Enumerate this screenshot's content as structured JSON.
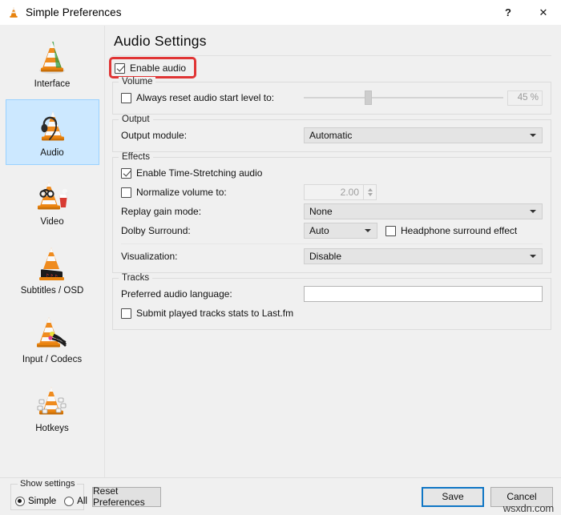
{
  "window": {
    "title": "Simple Preferences",
    "icon": "vlc-cone-icon",
    "help_label": "?",
    "close_label": "✕"
  },
  "sidebar": {
    "items": [
      {
        "label": "Interface",
        "icon": "vlc-cone-icon",
        "selected": false
      },
      {
        "label": "Audio",
        "icon": "vlc-cone-headphones-icon",
        "selected": true
      },
      {
        "label": "Video",
        "icon": "vlc-cone-popcorn-icon",
        "selected": false
      },
      {
        "label": "Subtitles / OSD",
        "icon": "vlc-cone-subtitles-icon",
        "selected": false
      },
      {
        "label": "Input / Codecs",
        "icon": "vlc-cone-cables-icon",
        "selected": false
      },
      {
        "label": "Hotkeys",
        "icon": "vlc-cone-keyboard-icon",
        "selected": false
      }
    ]
  },
  "content": {
    "page_title": "Audio Settings",
    "enable_audio": {
      "label": "Enable audio",
      "checked": true,
      "highlight_color": "#e03434"
    },
    "volume": {
      "group_label": "Volume",
      "reset_label": "Always reset audio start level to:",
      "reset_checked": false,
      "slider_value": "45 %",
      "slider_percent": 32
    },
    "output": {
      "group_label": "Output",
      "module_label": "Output module:",
      "module_value": "Automatic"
    },
    "effects": {
      "group_label": "Effects",
      "time_stretch_label": "Enable Time-Stretching audio",
      "time_stretch_checked": true,
      "normalize_label": "Normalize volume to:",
      "normalize_checked": false,
      "normalize_value": "2.00",
      "replay_gain_label": "Replay gain mode:",
      "replay_gain_value": "None",
      "dolby_label": "Dolby Surround:",
      "dolby_value": "Auto",
      "headphone_label": "Headphone surround effect",
      "headphone_checked": false,
      "visualization_label": "Visualization:",
      "visualization_value": "Disable"
    },
    "tracks": {
      "group_label": "Tracks",
      "language_label": "Preferred audio language:",
      "language_value": "",
      "lastfm_label": "Submit played tracks stats to Last.fm",
      "lastfm_checked": false
    }
  },
  "bottom": {
    "show_settings_label": "Show settings",
    "simple_label": "Simple",
    "all_label": "All",
    "simple_selected": true,
    "reset_label": "Reset Preferences",
    "save_label": "Save",
    "cancel_label": "Cancel"
  },
  "watermark": {
    "text": "wsxdn.com"
  }
}
